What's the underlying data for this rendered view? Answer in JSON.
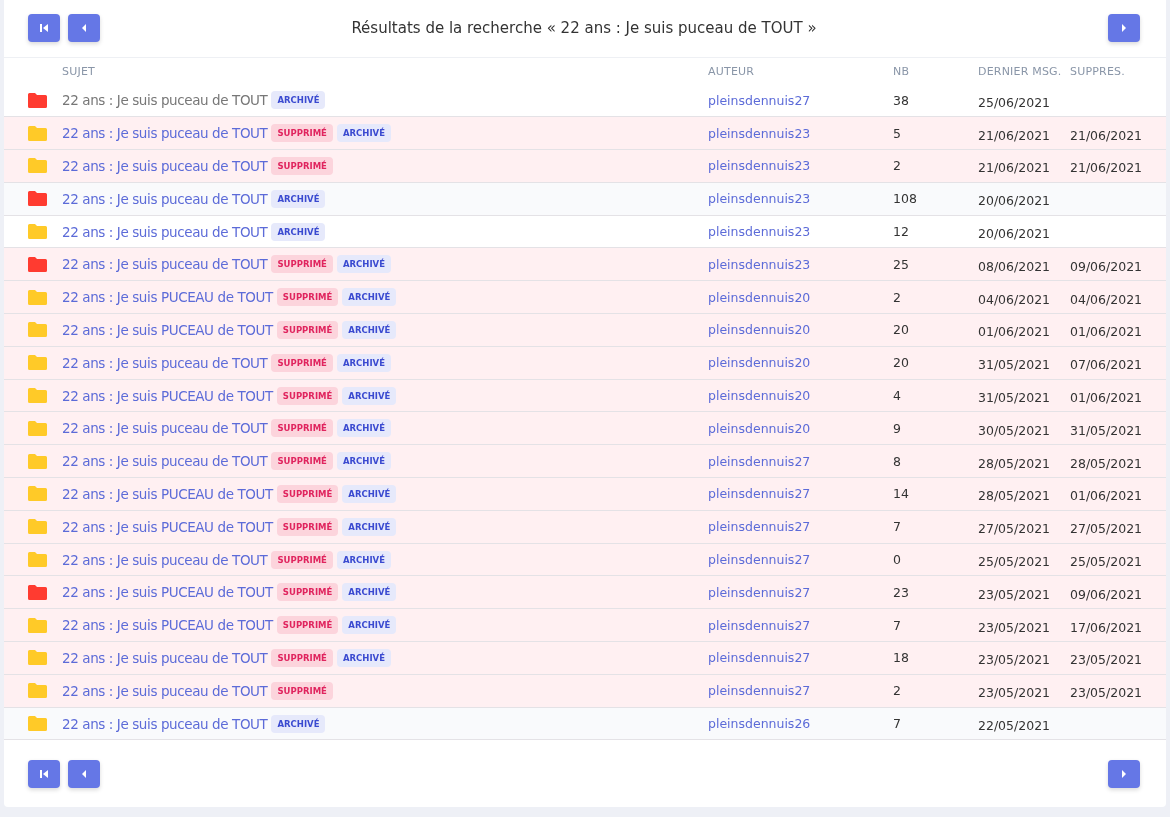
{
  "title": "Résultats de la recherche « 22 ans : Je suis puceau de TOUT »",
  "columns": [
    "SUJET",
    "AUTEUR",
    "NB",
    "DERNIER MSG.",
    "SUPPRES."
  ],
  "rows": [
    {
      "color": "#ff3b30",
      "visited": true,
      "subject": "22 ans : Je suis puceau de TOUT",
      "badges": [
        {
          "kind": "archived",
          "label": "ARCHIVÉ"
        }
      ],
      "author": "pleinsdennuis27",
      "nb": "38",
      "last": "25/06/2021"
    },
    {
      "color": "#ffca28",
      "visited": false,
      "subject": "22 ans : Je suis puceau de TOUT",
      "badges": [
        {
          "kind": "deleted",
          "label": "SUPPRIMÉ"
        },
        {
          "kind": "archived",
          "label": "ARCHIVÉ"
        }
      ],
      "author": "pleinsdennuis23",
      "nb": "5",
      "last": "21/06/2021",
      "deleted_on": "21/06/2021"
    },
    {
      "color": "#ffca28",
      "visited": false,
      "subject": "22 ans : Je suis puceau de TOUT",
      "badges": [
        {
          "kind": "deleted",
          "label": "SUPPRIMÉ"
        }
      ],
      "author": "pleinsdennuis23",
      "nb": "2",
      "last": "21/06/2021",
      "deleted_on": "21/06/2021"
    },
    {
      "color": "#ff3b30",
      "visited": false,
      "subject": "22 ans : Je suis puceau de TOUT",
      "badges": [
        {
          "kind": "archived",
          "label": "ARCHIVÉ"
        }
      ],
      "author": "pleinsdennuis23",
      "nb": "108",
      "last": "20/06/2021"
    },
    {
      "color": "#ffca28",
      "visited": false,
      "subject": "22 ans : Je suis puceau de TOUT",
      "badges": [
        {
          "kind": "archived",
          "label": "ARCHIVÉ"
        }
      ],
      "author": "pleinsdennuis23",
      "nb": "12",
      "last": "20/06/2021"
    },
    {
      "color": "#ff3b30",
      "visited": false,
      "subject": "22 ans : Je suis puceau de TOUT",
      "badges": [
        {
          "kind": "deleted",
          "label": "SUPPRIMÉ"
        },
        {
          "kind": "archived",
          "label": "ARCHIVÉ"
        }
      ],
      "author": "pleinsdennuis23",
      "nb": "25",
      "last": "08/06/2021",
      "deleted_on": "09/06/2021"
    },
    {
      "color": "#ffca28",
      "visited": false,
      "subject": "22 ans : Je suis PUCEAU de TOUT",
      "badges": [
        {
          "kind": "deleted",
          "label": "SUPPRIMÉ"
        },
        {
          "kind": "archived",
          "label": "ARCHIVÉ"
        }
      ],
      "author": "pleinsdennuis20",
      "nb": "2",
      "last": "04/06/2021",
      "deleted_on": "04/06/2021"
    },
    {
      "color": "#ffca28",
      "visited": false,
      "subject": "22 ans : Je suis PUCEAU de TOUT",
      "badges": [
        {
          "kind": "deleted",
          "label": "SUPPRIMÉ"
        },
        {
          "kind": "archived",
          "label": "ARCHIVÉ"
        }
      ],
      "author": "pleinsdennuis20",
      "nb": "20",
      "last": "01/06/2021",
      "deleted_on": "01/06/2021"
    },
    {
      "color": "#ffca28",
      "visited": false,
      "subject": "22 ans : Je suis puceau de TOUT",
      "badges": [
        {
          "kind": "deleted",
          "label": "SUPPRIMÉ"
        },
        {
          "kind": "archived",
          "label": "ARCHIVÉ"
        }
      ],
      "author": "pleinsdennuis20",
      "nb": "20",
      "last": "31/05/2021",
      "deleted_on": "07/06/2021"
    },
    {
      "color": "#ffca28",
      "visited": false,
      "subject": "22 ans : Je suis PUCEAU de TOUT",
      "badges": [
        {
          "kind": "deleted",
          "label": "SUPPRIMÉ"
        },
        {
          "kind": "archived",
          "label": "ARCHIVÉ"
        }
      ],
      "author": "pleinsdennuis20",
      "nb": "4",
      "last": "31/05/2021",
      "deleted_on": "01/06/2021"
    },
    {
      "color": "#ffca28",
      "visited": false,
      "subject": "22 ans : Je suis puceau de TOUT",
      "badges": [
        {
          "kind": "deleted",
          "label": "SUPPRIMÉ"
        },
        {
          "kind": "archived",
          "label": "ARCHIVÉ"
        }
      ],
      "author": "pleinsdennuis20",
      "nb": "9",
      "last": "30/05/2021",
      "deleted_on": "31/05/2021"
    },
    {
      "color": "#ffca28",
      "visited": false,
      "subject": "22 ans : Je suis puceau de TOUT",
      "badges": [
        {
          "kind": "deleted",
          "label": "SUPPRIMÉ"
        },
        {
          "kind": "archived",
          "label": "ARCHIVÉ"
        }
      ],
      "author": "pleinsdennuis27",
      "nb": "8",
      "last": "28/05/2021",
      "deleted_on": "28/05/2021"
    },
    {
      "color": "#ffca28",
      "visited": false,
      "subject": "22 ans : Je suis PUCEAU de TOUT",
      "badges": [
        {
          "kind": "deleted",
          "label": "SUPPRIMÉ"
        },
        {
          "kind": "archived",
          "label": "ARCHIVÉ"
        }
      ],
      "author": "pleinsdennuis27",
      "nb": "14",
      "last": "28/05/2021",
      "deleted_on": "01/06/2021"
    },
    {
      "color": "#ffca28",
      "visited": false,
      "subject": "22 ans : Je suis PUCEAU de TOUT",
      "badges": [
        {
          "kind": "deleted",
          "label": "SUPPRIMÉ"
        },
        {
          "kind": "archived",
          "label": "ARCHIVÉ"
        }
      ],
      "author": "pleinsdennuis27",
      "nb": "7",
      "last": "27/05/2021",
      "deleted_on": "27/05/2021"
    },
    {
      "color": "#ffca28",
      "visited": false,
      "subject": "22 ans : Je suis puceau de TOUT",
      "badges": [
        {
          "kind": "deleted",
          "label": "SUPPRIMÉ"
        },
        {
          "kind": "archived",
          "label": "ARCHIVÉ"
        }
      ],
      "author": "pleinsdennuis27",
      "nb": "0",
      "last": "25/05/2021",
      "deleted_on": "25/05/2021"
    },
    {
      "color": "#ff3b30",
      "visited": false,
      "subject": "22 ans : Je suis PUCEAU de TOUT",
      "badges": [
        {
          "kind": "deleted",
          "label": "SUPPRIMÉ"
        },
        {
          "kind": "archived",
          "label": "ARCHIVÉ"
        }
      ],
      "author": "pleinsdennuis27",
      "nb": "23",
      "last": "23/05/2021",
      "deleted_on": "09/06/2021"
    },
    {
      "color": "#ffca28",
      "visited": false,
      "subject": "22 ans : Je suis PUCEAU de TOUT",
      "badges": [
        {
          "kind": "deleted",
          "label": "SUPPRIMÉ"
        },
        {
          "kind": "archived",
          "label": "ARCHIVÉ"
        }
      ],
      "author": "pleinsdennuis27",
      "nb": "7",
      "last": "23/05/2021",
      "deleted_on": "17/06/2021"
    },
    {
      "color": "#ffca28",
      "visited": false,
      "subject": "22 ans : Je suis puceau de TOUT",
      "badges": [
        {
          "kind": "deleted",
          "label": "SUPPRIMÉ"
        },
        {
          "kind": "archived",
          "label": "ARCHIVÉ"
        }
      ],
      "author": "pleinsdennuis27",
      "nb": "18",
      "last": "23/05/2021",
      "deleted_on": "23/05/2021"
    },
    {
      "color": "#ffca28",
      "visited": false,
      "subject": "22 ans : Je suis puceau de TOUT",
      "badges": [
        {
          "kind": "deleted",
          "label": "SUPPRIMÉ"
        }
      ],
      "author": "pleinsdennuis27",
      "nb": "2",
      "last": "23/05/2021",
      "deleted_on": "23/05/2021"
    },
    {
      "color": "#ffca28",
      "visited": false,
      "subject": "22 ans : Je suis puceau de TOUT",
      "badges": [
        {
          "kind": "archived",
          "label": "ARCHIVÉ"
        }
      ],
      "author": "pleinsdennuis26",
      "nb": "7",
      "last": "22/05/2021"
    }
  ]
}
